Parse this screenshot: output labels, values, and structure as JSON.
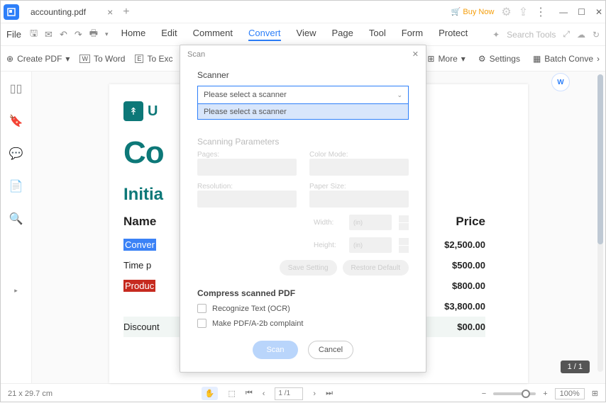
{
  "titlebar": {
    "app": "P",
    "tab": "accounting.pdf",
    "buy_now": "Buy Now"
  },
  "menu": {
    "file": "File",
    "items": [
      "Home",
      "Edit",
      "Comment",
      "Convert",
      "View",
      "Page",
      "Tool",
      "Form",
      "Protect"
    ],
    "active": "Convert",
    "search_ph": "Search Tools"
  },
  "toolbar": {
    "create": "Create PDF",
    "to_word": "To Word",
    "to_excel": "To Exc",
    "more": "More",
    "settings": "Settings",
    "batch": "Batch Conve"
  },
  "doc": {
    "logo": "U",
    "co": "Co",
    "subtitle": "Initia",
    "head_name": "Name",
    "head_price": "Price",
    "rows": [
      {
        "label": "Conver",
        "price": "$2,500.00",
        "style": "blue"
      },
      {
        "label": "Time p",
        "price": "$500.00",
        "style": ""
      },
      {
        "label": "Produc",
        "price": "$800.00",
        "style": "red"
      },
      {
        "label": "",
        "price": "$3,800.00",
        "style": ""
      },
      {
        "label": "Discount",
        "price": "$00.00",
        "style": "alt"
      }
    ]
  },
  "dialog": {
    "title": "Scan",
    "scanner_lbl": "Scanner",
    "select_ph": "Please select a scanner",
    "option1": "Please select a scanner",
    "params_title": "Scanning Parameters",
    "pages": "Pages:",
    "colormode": "Color Mode:",
    "resolution": "Resolution:",
    "papersize": "Paper Size:",
    "width": "Width:",
    "height": "Height:",
    "unit": "(in)",
    "save_setting": "Save Setting",
    "restore": "Restore Default",
    "compress": "Compress scanned PDF",
    "ocr": "Recognize Text (OCR)",
    "pdfa": "Make PDF/A-2b complaint",
    "scan_btn": "Scan",
    "cancel_btn": "Cancel"
  },
  "status": {
    "dims": "21 x 29.7 cm",
    "page": "1 /1",
    "zoom": "100%",
    "page_badge": "1 / 1"
  }
}
